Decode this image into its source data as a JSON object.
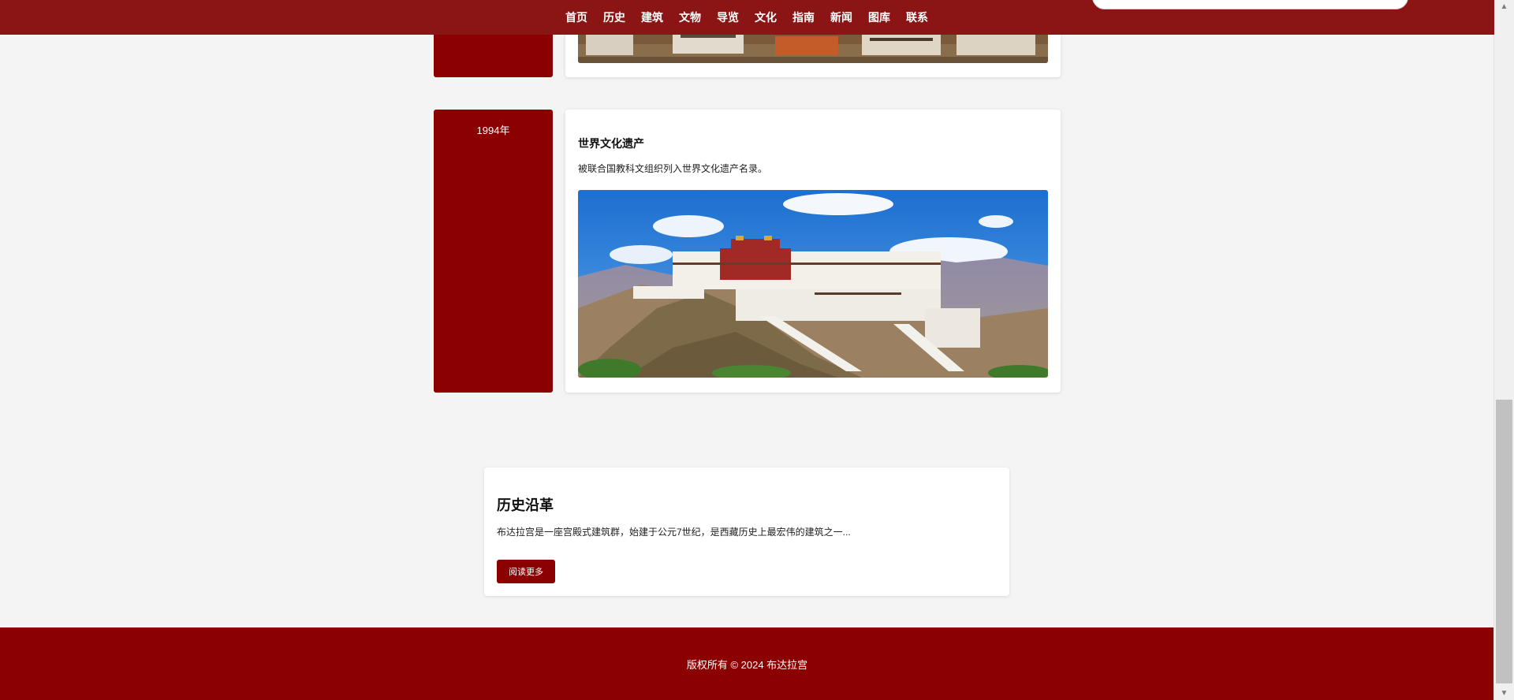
{
  "nav": {
    "items": [
      "首页",
      "历史",
      "建筑",
      "文物",
      "导览",
      "文化",
      "指南",
      "新闻",
      "图库",
      "联系"
    ]
  },
  "timeline": [
    {
      "year": "",
      "title": "",
      "desc": ""
    },
    {
      "year": "1994年",
      "title": "世界文化遗产",
      "desc": "被联合国教科文组织列入世界文化遗产名录。"
    }
  ],
  "history": {
    "title": "历史沿革",
    "desc": "布达拉宫是一座宫殿式建筑群，始建于公元7世纪，是西藏历史上最宏伟的建筑之一...",
    "button": "阅读更多"
  },
  "footer": {
    "text": "版权所有 © 2024 布达拉宫"
  },
  "colors": {
    "primary": "#8b0000",
    "header": "#8b1414",
    "background": "#f4f4f4"
  },
  "scrollbar": {
    "position_fraction": 0.57
  }
}
